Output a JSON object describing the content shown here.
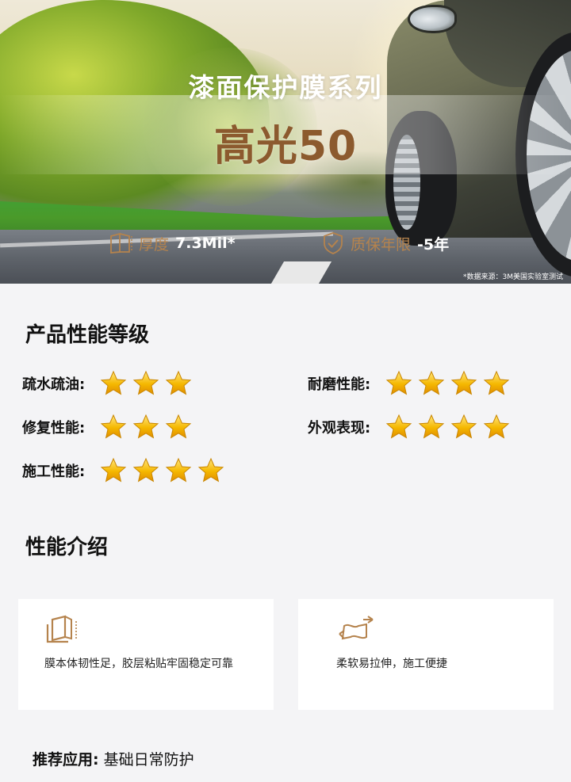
{
  "hero": {
    "title": "漆面保护膜系列",
    "subtitle": "高光50",
    "thickness_label": "厚度",
    "thickness_value": "7.3Mil*",
    "warranty_label": "质保年限",
    "warranty_value": "-5年",
    "source_note": "*数据来源：3M美国实验室测试"
  },
  "rating": {
    "title": "产品性能等级",
    "items": [
      {
        "label": "疏水疏油:",
        "stars": 3
      },
      {
        "label": "修复性能:",
        "stars": 3
      },
      {
        "label": "施工性能:",
        "stars": 4
      },
      {
        "label": "耐磨性能:",
        "stars": 4
      },
      {
        "label": "外观表现:",
        "stars": 4
      }
    ]
  },
  "performance": {
    "title": "性能介绍",
    "cards": [
      {
        "icon": "film-layer-icon",
        "text": "膜本体韧性足，胶层粘贴牢固稳定可靠"
      },
      {
        "icon": "stretch-film-icon",
        "text": "柔软易拉伸，施工便捷"
      }
    ]
  },
  "recommend": {
    "label": "推荐应用:",
    "value": " 基础日常防护"
  },
  "colors": {
    "accent_gold": "#b5834d",
    "title_brown": "#8c5a2e",
    "background": "#f4f4f6"
  }
}
